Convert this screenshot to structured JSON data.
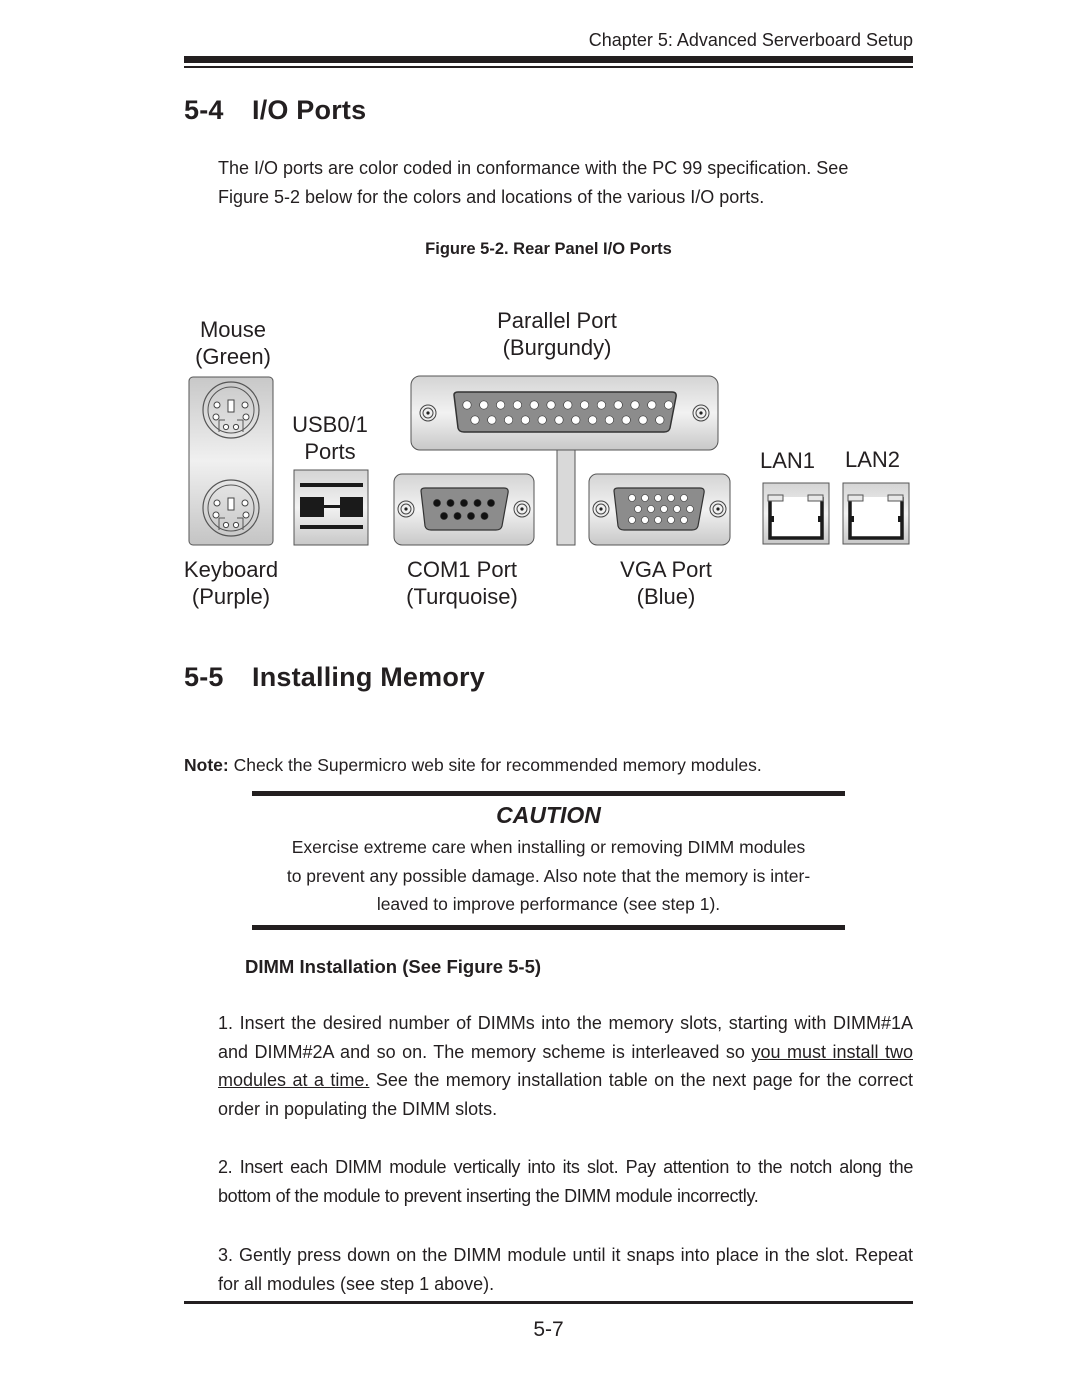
{
  "header": {
    "chapter_title": "Chapter 5: Advanced Serverboard Setup"
  },
  "section_io": {
    "number": "5-4",
    "title": "I/O Ports",
    "paragraph_line1": "The I/O ports are color coded in conformance with the PC 99 specification.  See",
    "paragraph_line2": "Figure 5-2 below for the colors and locations of the various I/O ports.",
    "figure_caption": "Figure 5-2. Rear Panel I/O Ports"
  },
  "figure": {
    "labels": {
      "mouse": "Mouse",
      "mouse_color": "(Green)",
      "keyboard": "Keyboard",
      "keyboard_color": "(Purple)",
      "usb": "USB0/1",
      "usb_sub": "Ports",
      "parallel": "Parallel Port",
      "parallel_color": "(Burgundy)",
      "com1": "COM1 Port",
      "com1_color": "(Turquoise)",
      "vga": "VGA Port",
      "vga_color": "(Blue)",
      "lan1": "LAN1",
      "lan2": "LAN2"
    },
    "pin_counts": {
      "parallel_top_row": 13,
      "parallel_bottom_row": 12,
      "com_top_row": 5,
      "com_bottom_row": 4,
      "vga_rows": [
        5,
        5,
        5
      ]
    }
  },
  "section_memory": {
    "number": "5-5",
    "title": "Installing Memory",
    "note_label": "Note:",
    "note_text": " Check the Supermicro web site for recommended memory modules.",
    "caution": {
      "title": "CAUTION",
      "line1": "Exercise extreme care when installing or removing DIMM modules",
      "line2": "to prevent any possible damage.  Also note that the memory is inter-",
      "line3": "leaved to improve performance (see step 1)."
    },
    "subheading": "DIMM Installation (See Figure 5-5)",
    "steps": [
      {
        "before": "1. Insert the desired number of DIMMs into the memory slots, starting with DIMM#1A and DIMM#2A and so on.  The memory scheme is interleaved so ",
        "underlined": "you must install two modules at a time.",
        "after": "  See the memory installation table on the next page for the correct order in populating the DIMM slots."
      },
      {
        "text": "2. Insert each DIMM module vertically into its slot.  Pay attention to the  notch along the bottom of the module to prevent inserting the DIMM module incorrectly."
      },
      {
        "text": "3. Gently press down on the DIMM module until it snaps into place in the slot. Repeat for all modules (see step 1 above)."
      }
    ]
  },
  "footer": {
    "page_number": "5-7"
  }
}
